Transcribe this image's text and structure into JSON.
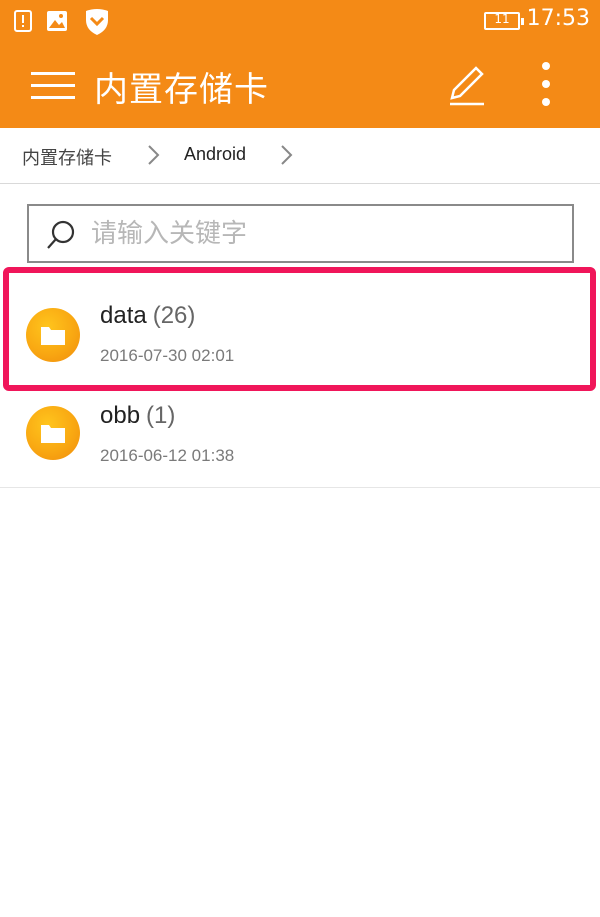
{
  "status_bar": {
    "time": "17:53",
    "battery_level": "11",
    "icons": [
      "alert-icon",
      "image-icon",
      "shield-icon"
    ]
  },
  "app_bar": {
    "title": "内置存储卡",
    "icons": [
      "menu-icon",
      "edit-icon",
      "more-vert-icon"
    ]
  },
  "breadcrumb": [
    "内置存储卡",
    "Android"
  ],
  "search": {
    "value": "",
    "placeholder": "请输入关键字"
  },
  "files": [
    {
      "name": "data",
      "count": "(26)",
      "date": "2016-07-30 02:01",
      "highlighted": true
    },
    {
      "name": "obb",
      "count": "(1)",
      "date": "2016-06-12 01:38",
      "highlighted": false
    }
  ],
  "colors": {
    "accent": "#f48a16",
    "highlight": "#f0165a",
    "folder": "#f9a812"
  }
}
